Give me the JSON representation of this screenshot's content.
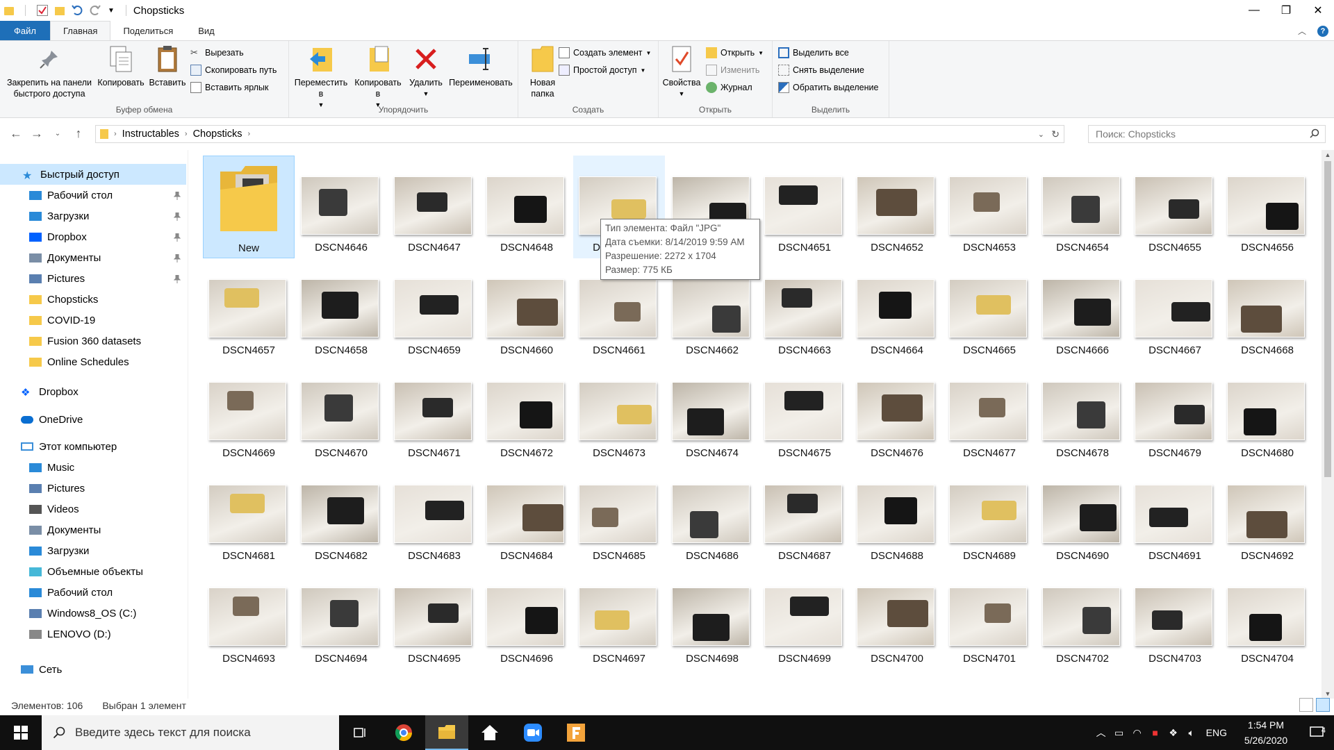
{
  "window": {
    "title": "Chopsticks",
    "controls": [
      "—",
      "❐",
      "✕"
    ]
  },
  "ribbon_tabs": [
    "Файл",
    "Главная",
    "Поделиться",
    "Вид"
  ],
  "ribbon": {
    "pin": "Закрепить на панели быстрого доступа",
    "copy": "Копировать",
    "paste": "Вставить",
    "cut": "Вырезать",
    "copy_path": "Скопировать путь",
    "paste_shortcut": "Вставить ярлык",
    "clipboard_group": "Буфер обмена",
    "move_to": "Переместить в",
    "copy_to": "Копировать в",
    "delete": "Удалить",
    "rename": "Переименовать",
    "organize_group": "Упорядочить",
    "new_folder": "Новая папка",
    "new_item": "Создать элемент",
    "easy_access": "Простой доступ",
    "create_group": "Создать",
    "properties": "Свойства",
    "open": "Открыть",
    "edit": "Изменить",
    "history": "Журнал",
    "open_group": "Открыть",
    "select_all": "Выделить все",
    "select_none": "Снять выделение",
    "invert_selection": "Обратить выделение",
    "select_group": "Выделить"
  },
  "address": {
    "crumbs": [
      "Instructables",
      "Chopsticks"
    ],
    "search_placeholder": "Поиск: Chopsticks"
  },
  "nav": {
    "quick_access": "Быстрый доступ",
    "items": [
      {
        "label": "Рабочий стол",
        "pinned": true
      },
      {
        "label": "Загрузки",
        "pinned": true
      },
      {
        "label": "Dropbox",
        "pinned": true
      },
      {
        "label": "Документы",
        "pinned": true
      },
      {
        "label": "Pictures",
        "pinned": true
      },
      {
        "label": "Chopsticks",
        "pinned": false
      },
      {
        "label": "COVID-19",
        "pinned": false
      },
      {
        "label": "Fusion 360 datasets",
        "pinned": false
      },
      {
        "label": "Online Schedules",
        "pinned": false
      }
    ],
    "dropbox": "Dropbox",
    "onedrive": "OneDrive",
    "this_pc": "Этот компьютер",
    "pc_items": [
      "Music",
      "Pictures",
      "Videos",
      "Документы",
      "Загрузки",
      "Объемные объекты",
      "Рабочий стол",
      "Windows8_OS (C:)",
      "LENOVO (D:)"
    ],
    "network": "Сеть"
  },
  "files": [
    "New",
    "DSCN4646",
    "DSCN4647",
    "DSCN4648",
    "DSCN4650",
    "DSCN4649",
    "DSCN4651",
    "DSCN4652",
    "DSCN4653",
    "DSCN4654",
    "DSCN4655",
    "DSCN4656",
    "DSCN4657",
    "DSCN4658",
    "DSCN4659",
    "DSCN4660",
    "DSCN4661",
    "DSCN4662",
    "DSCN4663",
    "DSCN4664",
    "DSCN4665",
    "DSCN4666",
    "DSCN4667",
    "DSCN4668",
    "DSCN4669",
    "DSCN4670",
    "DSCN4671",
    "DSCN4672",
    "DSCN4673",
    "DSCN4674",
    "DSCN4675",
    "DSCN4676",
    "DSCN4677",
    "DSCN4678",
    "DSCN4679",
    "DSCN4680",
    "DSCN4681",
    "DSCN4682",
    "DSCN4683",
    "DSCN4684",
    "DSCN4685",
    "DSCN4686",
    "DSCN4687",
    "DSCN4688",
    "DSCN4689",
    "DSCN4690",
    "DSCN4691",
    "DSCN4692",
    "DSCN4693",
    "DSCN4694",
    "DSCN4695",
    "DSCN4696",
    "DSCN4697",
    "DSCN4698",
    "DSCN4699",
    "DSCN4700",
    "DSCN4701",
    "DSCN4702",
    "DSCN4703",
    "DSCN4704"
  ],
  "tooltip": {
    "type": "Тип элемента: Файл \"JPG\"",
    "date": "Дата съемки: 8/14/2019 9:59 AM",
    "resolution": "Разрешение: 2272 x 1704",
    "size": "Размер: 775 КБ"
  },
  "status": {
    "count": "Элементов: 106",
    "selected": "Выбран 1 элемент"
  },
  "taskbar": {
    "search_placeholder": "Введите здесь текст для поиска",
    "lang": "ENG",
    "time": "1:54 PM",
    "date": "5/26/2020",
    "notifications": "4"
  }
}
